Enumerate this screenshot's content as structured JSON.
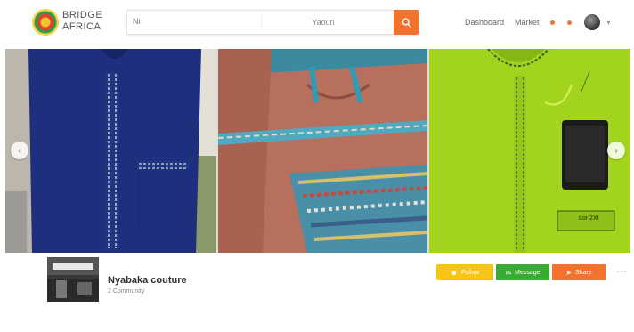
{
  "brand": {
    "line1": "BRIDGE",
    "line2": "AFRICA"
  },
  "search": {
    "placeholder": "Ni",
    "location": "Yaoun"
  },
  "nav": {
    "link1": "Dashboard",
    "link2": "Market"
  },
  "icons": {
    "search": "search-icon",
    "notifications": "dot-icon",
    "arrow_left": "chevron-left-icon",
    "arrow_right": "chevron-right-icon",
    "account_menu": "chevron-down-icon",
    "follow": "person-add-icon",
    "message": "chat-icon",
    "share": "share-icon",
    "more": "more-icon"
  },
  "carousel": {
    "arrow_left": "‹",
    "arrow_right": "›",
    "price_tag": "Lor 2Xt"
  },
  "business": {
    "name": "Nyabaka couture",
    "subtitle": "2 Community"
  },
  "actions": {
    "follow": "Follow",
    "message": "Message",
    "share": "Share",
    "more": "···"
  },
  "colors": {
    "accent": "#f3722c",
    "follow": "#f5c518",
    "message": "#3aaa35"
  }
}
